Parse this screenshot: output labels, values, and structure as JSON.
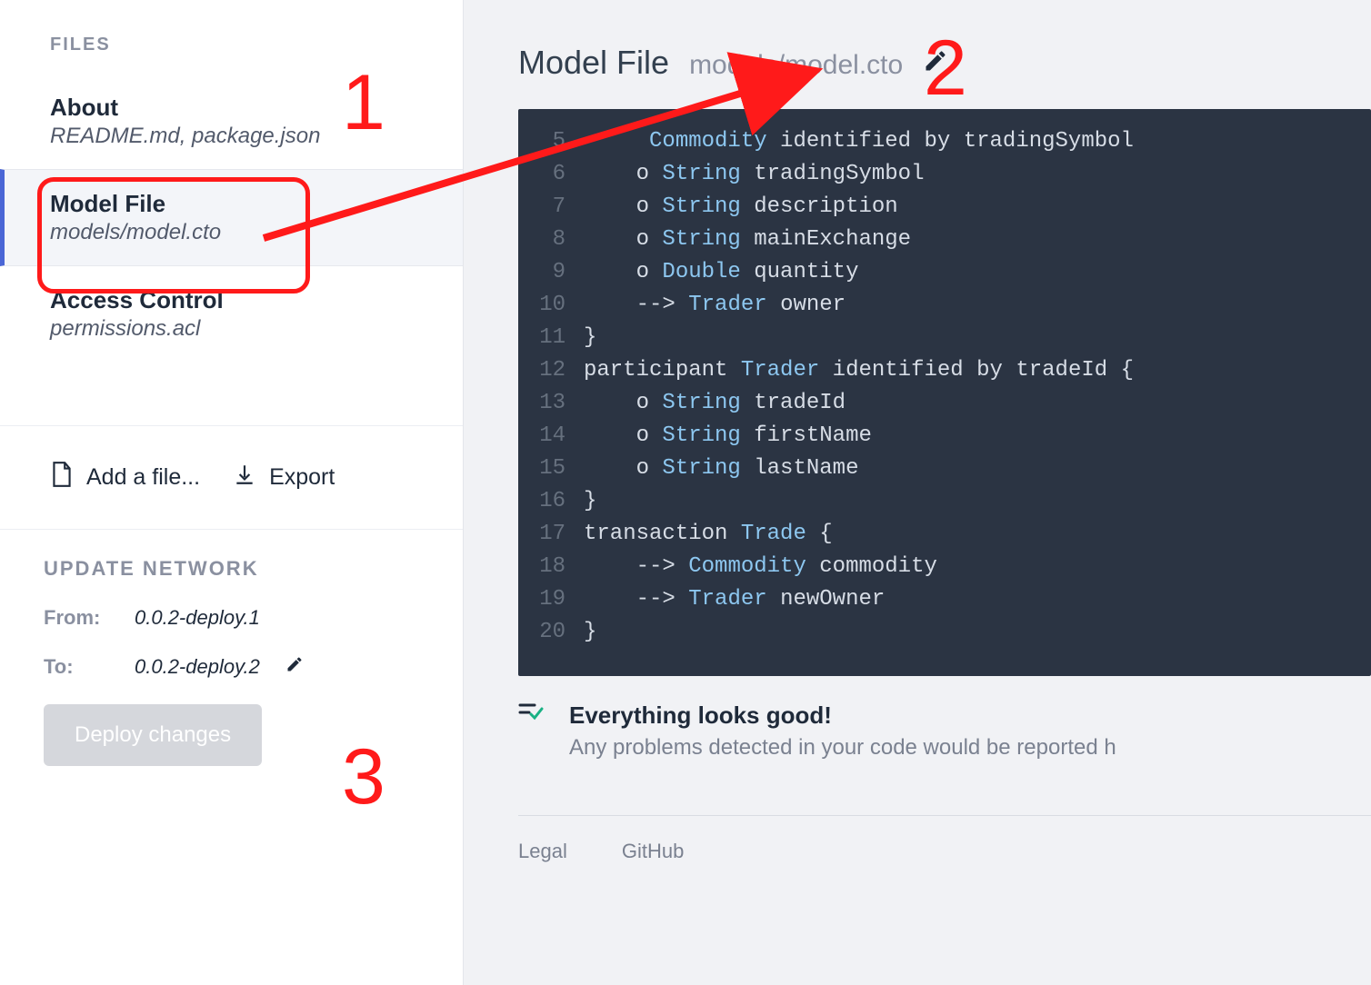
{
  "sidebar": {
    "files_heading": "FILES",
    "items": [
      {
        "title": "About",
        "path": "README.md, package.json",
        "selected": false
      },
      {
        "title": "Model File",
        "path": "models/model.cto",
        "selected": true
      },
      {
        "title": "Access Control",
        "path": "permissions.acl",
        "selected": false
      }
    ],
    "add_file_label": "Add a file...",
    "export_label": "Export"
  },
  "update": {
    "heading": "UPDATE NETWORK",
    "from_label": "From:",
    "from_value": "0.0.2-deploy.1",
    "to_label": "To:",
    "to_value": "0.0.2-deploy.2",
    "deploy_label": "Deploy changes"
  },
  "main": {
    "title": "Model File",
    "path": "models/model.cto"
  },
  "code_lines": [
    {
      "n": 5,
      "text": "     Commodity identified by tradingSymbol "
    },
    {
      "n": 6,
      "text": "    o String tradingSymbol"
    },
    {
      "n": 7,
      "text": "    o String description"
    },
    {
      "n": 8,
      "text": "    o String mainExchange"
    },
    {
      "n": 9,
      "text": "    o Double quantity"
    },
    {
      "n": 10,
      "text": "    --> Trader owner"
    },
    {
      "n": 11,
      "text": "}"
    },
    {
      "n": 12,
      "text": "participant Trader identified by tradeId {"
    },
    {
      "n": 13,
      "text": "    o String tradeId"
    },
    {
      "n": 14,
      "text": "    o String firstName"
    },
    {
      "n": 15,
      "text": "    o String lastName"
    },
    {
      "n": 16,
      "text": "}"
    },
    {
      "n": 17,
      "text": "transaction Trade {"
    },
    {
      "n": 18,
      "text": "    --> Commodity commodity"
    },
    {
      "n": 19,
      "text": "    --> Trader newOwner"
    },
    {
      "n": 20,
      "text": "}"
    }
  ],
  "status": {
    "title": "Everything looks good!",
    "subtitle": "Any problems detected in your code would be reported h"
  },
  "footer": {
    "legal": "Legal",
    "github": "GitHub"
  },
  "annotations": {
    "num1": "1",
    "num2": "2",
    "num3": "3"
  }
}
